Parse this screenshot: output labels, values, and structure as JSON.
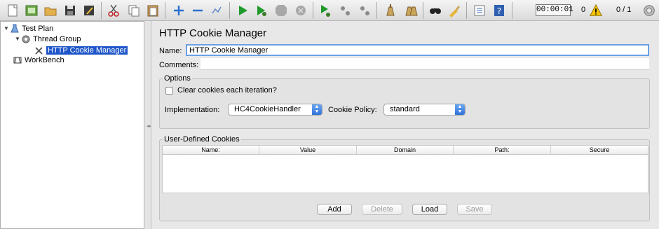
{
  "toolbar": {
    "buttons": [
      {
        "name": "new-icon"
      },
      {
        "name": "templates-icon"
      },
      {
        "name": "open-icon"
      },
      {
        "name": "save-icon"
      },
      {
        "name": "save-as-icon"
      },
      {
        "name": "cut-icon"
      },
      {
        "name": "copy-icon"
      },
      {
        "name": "paste-icon"
      },
      {
        "name": "expand-icon"
      },
      {
        "name": "collapse-icon"
      },
      {
        "name": "toggle-icon"
      },
      {
        "name": "start-icon"
      },
      {
        "name": "start-no-pauses-icon"
      },
      {
        "name": "stop-icon"
      },
      {
        "name": "shutdown-icon"
      },
      {
        "name": "remote-start-icon"
      },
      {
        "name": "remote-stop-icon"
      },
      {
        "name": "remote-shutdown-icon"
      },
      {
        "name": "clear-icon"
      },
      {
        "name": "clear-all-icon"
      },
      {
        "name": "search-icon"
      },
      {
        "name": "reset-search-icon"
      },
      {
        "name": "function-helper-icon"
      },
      {
        "name": "help-icon"
      }
    ],
    "timer": "00:00:01",
    "error_count": "0",
    "threads": "0 / 1"
  },
  "tree": {
    "test_plan": "Test Plan",
    "thread_group": "Thread Group",
    "cookie_manager": "HTTP Cookie Manager",
    "workbench": "WorkBench"
  },
  "panel": {
    "title": "HTTP Cookie Manager",
    "name_label": "Name:",
    "name_value": "HTTP Cookie Manager",
    "comments_label": "Comments:",
    "comments_value": "",
    "options_legend": "Options",
    "clear_cookies_label": "Clear cookies each iteration?",
    "clear_cookies_checked": false,
    "implementation_label": "Implementation:",
    "implementation_value": "HC4CookieHandler",
    "policy_label": "Cookie Policy:",
    "policy_value": "standard",
    "udc_legend": "User-Defined Cookies",
    "columns": [
      "Name:",
      "Value",
      "Domain",
      "Path:",
      "Secure"
    ],
    "buttons": {
      "add": "Add",
      "delete": "Delete",
      "load": "Load",
      "save": "Save"
    }
  },
  "colors": {
    "selection": "#1f56c9",
    "focus": "#6b9fe6",
    "warning": "#f5c400"
  }
}
